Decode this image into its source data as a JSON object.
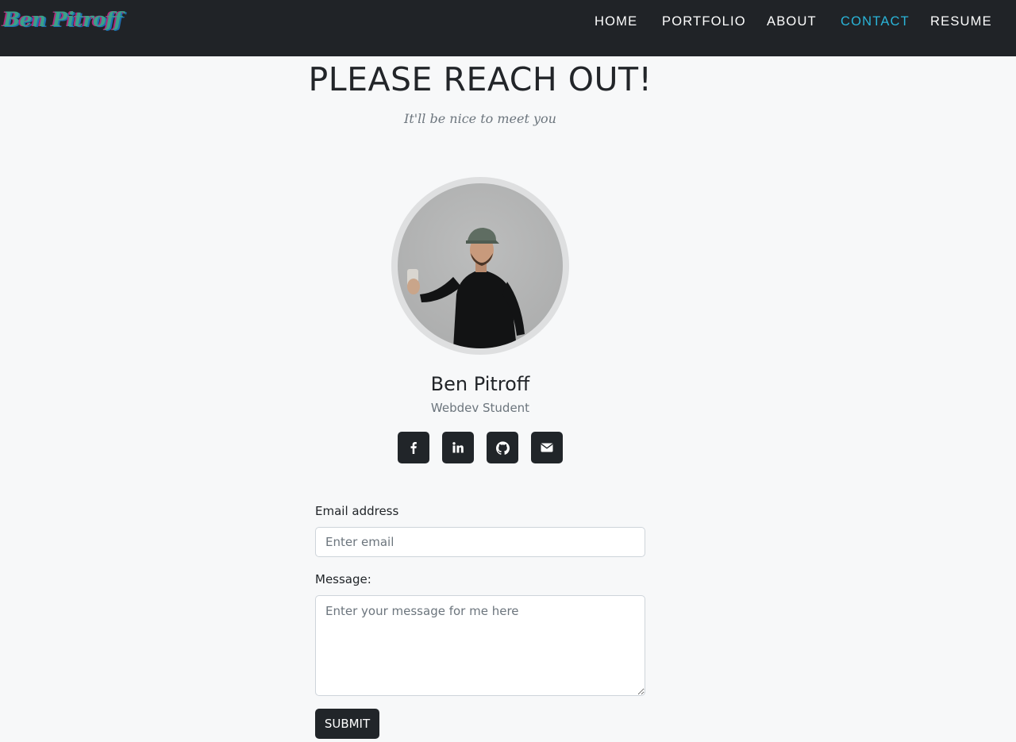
{
  "nav": {
    "brand": "Ben Pitroff",
    "links": [
      {
        "label": "HOME"
      },
      {
        "label": "PORTFOLIO"
      },
      {
        "label": "ABOUT"
      },
      {
        "label": "CONTACT",
        "active": true
      },
      {
        "label": "RESUME"
      }
    ]
  },
  "header": {
    "title": "PLEASE REACH OUT!",
    "subtitle": "It'll be nice to meet you"
  },
  "profile": {
    "name": "Ben Pitroff",
    "role": "Webdev Student"
  },
  "social": [
    {
      "icon": "facebook-icon"
    },
    {
      "icon": "linkedin-icon"
    },
    {
      "icon": "github-icon"
    },
    {
      "icon": "envelope-icon"
    }
  ],
  "form": {
    "email_label": "Email address",
    "email_placeholder": "Enter email",
    "email_value": "",
    "message_label": "Message:",
    "message_placeholder": "Enter your message for me here",
    "message_value": "",
    "submit_label": "SUBMIT"
  },
  "colors": {
    "navbar_bg": "#202327",
    "active_link": "#2ab4d8",
    "page_bg": "#f7f8f9",
    "button_bg": "#212529"
  }
}
